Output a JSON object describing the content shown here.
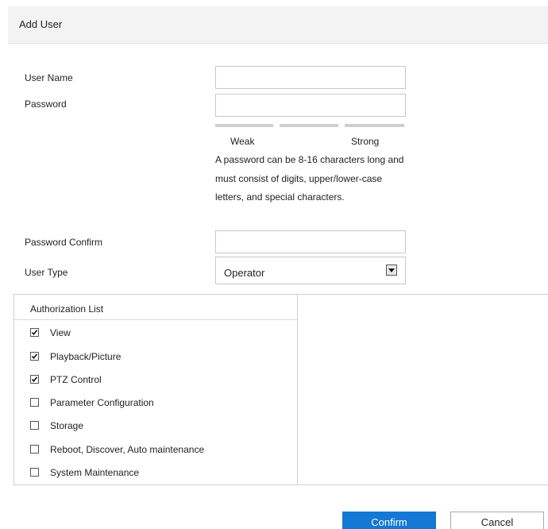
{
  "dialog": {
    "title": "Add User"
  },
  "form": {
    "user_name_label": "User Name",
    "user_name_value": "",
    "password_label": "Password",
    "password_value": "",
    "strength": {
      "weak_label": "Weak",
      "strong_label": "Strong"
    },
    "password_hint": "A password can be 8-16 characters long and must consist of digits, upper/lower-case letters, and special characters.",
    "password_confirm_label": "Password Confirm",
    "password_confirm_value": "",
    "user_type_label": "User Type",
    "user_type_value": "Operator"
  },
  "authorization": {
    "header": "Authorization List",
    "items": [
      {
        "label": "View",
        "checked": true
      },
      {
        "label": "Playback/Picture",
        "checked": true
      },
      {
        "label": "PTZ Control",
        "checked": true
      },
      {
        "label": "Parameter Configuration",
        "checked": false
      },
      {
        "label": "Storage",
        "checked": false
      },
      {
        "label": "Reboot, Discover, Auto maintenance",
        "checked": false
      },
      {
        "label": "System Maintenance",
        "checked": false
      }
    ]
  },
  "buttons": {
    "confirm_label": "Confirm",
    "cancel_label": "Cancel"
  },
  "colors": {
    "primary": "#1478d4",
    "title_bar_bg": "#f3f3f3",
    "border": "#cfcfcf"
  }
}
